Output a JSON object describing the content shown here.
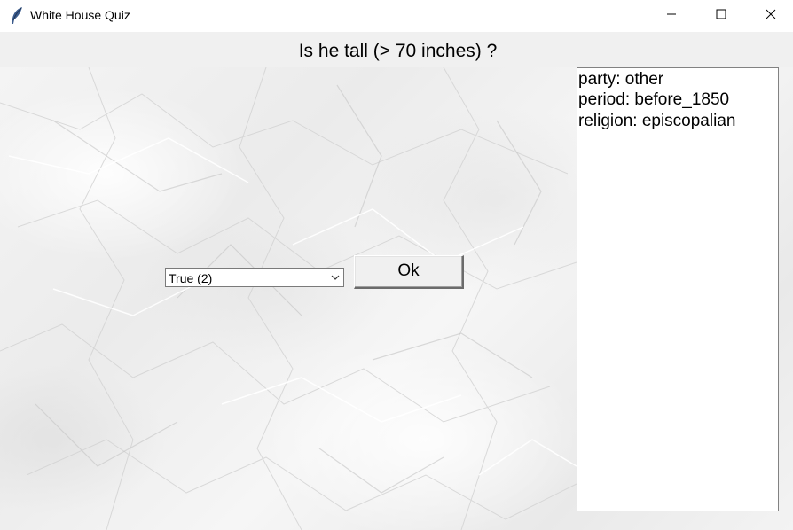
{
  "window": {
    "title": "White House Quiz",
    "app_icon": "feather-icon",
    "controls": {
      "minimize_icon": "minimize-icon",
      "maximize_icon": "maximize-icon",
      "close_icon": "close-icon"
    }
  },
  "question": {
    "text": "Is he tall (> 70 inches) ?"
  },
  "answer": {
    "selected": "True (2)",
    "dropdown_icon": "chevron-down-icon",
    "submit_label": "Ok"
  },
  "facts": {
    "items": [
      {
        "label": "party: other"
      },
      {
        "label": "period: before_1850"
      },
      {
        "label": "religion: episcopalian"
      }
    ]
  },
  "colors": {
    "titlebar_bg": "#ffffff",
    "header_bg": "#f0f0f0",
    "button_bg": "#f0f0f0",
    "panel_bg": "#ffffff",
    "text": "#000000"
  }
}
